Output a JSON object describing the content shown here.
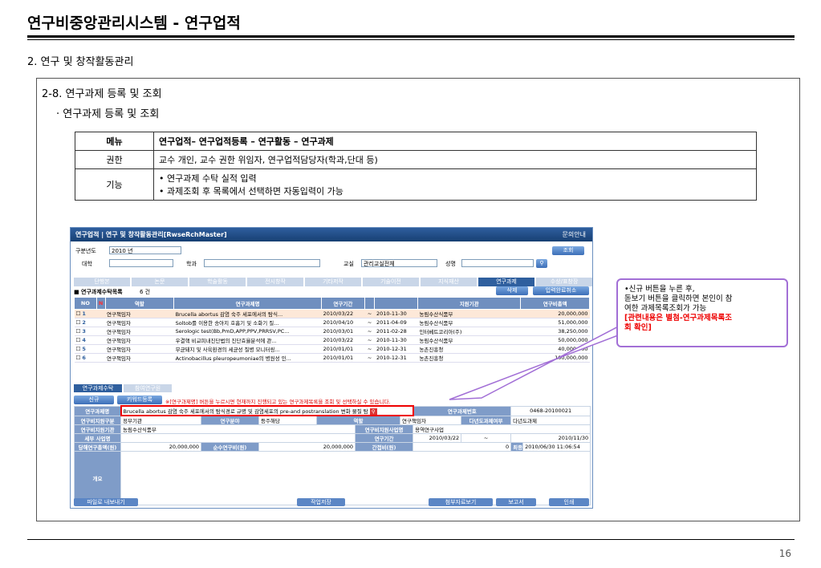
{
  "doc": {
    "title": "연구비중앙관리시스템 - 연구업적",
    "section": "2. 연구 및 창작활동관리",
    "subsection": "2-8. 연구과제 등록 및 조회",
    "subsubsection": "· 연구과제 등록 및 조회",
    "page_number": "16"
  },
  "info_table": {
    "menu_label": "메뉴",
    "menu_value": "연구업적– 연구업적등록 – 연구활동 – 연구과제",
    "auth_label": "권한",
    "auth_value": "교수 개인, 교수 권한 위임자, 연구업적담당자(학과,단대 등)",
    "func_label": "기능",
    "func_value_1": "• 연구과제 수탁 실적 입력",
    "func_value_2": "• 과제조회 후 목록에서 선택하면 자동입력이 가능"
  },
  "app": {
    "title": "연구업적 | 연구 및 창작활동관리[RwseRchMaster]",
    "help": "문의안내",
    "year_label": "구분년도",
    "year_value": "2010 년",
    "search_button": "조회",
    "college_label": "대학",
    "dept_label": "학과",
    "office_label": "교실",
    "office_value": "관리교실전체",
    "name_label": "성명",
    "tabs": [
      "단행본",
      "논문",
      "학술활동",
      "전시창작",
      "기타저작",
      "기술이전",
      "지식재산",
      "연구과제",
      "수상/표창장"
    ],
    "list_title": "■ 연구과제수탁목록",
    "list_count": "6 건",
    "btn_delete": "삭제",
    "btn_cancel": "입력완료취소",
    "grid_headers": [
      "NO",
      "N",
      "역할",
      "연구과제명",
      "연구기간",
      "",
      "",
      "지원기관",
      "연구비총액"
    ],
    "rows": [
      [
        "1",
        "연구책임자",
        "Brucella abortus 감염 숙주 세포에서의 탐식...",
        "2010/03/22",
        "~",
        "2010-11-30",
        "농림수산식품부",
        "20,000,000"
      ],
      [
        "2",
        "연구책임자",
        "Soltob를 이용한 송아지 호흡기 및 소화기 질...",
        "2010/04/10",
        "~",
        "2011-04-09",
        "농림수산식품부",
        "51,000,000"
      ],
      [
        "3",
        "연구책임자",
        "Serologic test(Bb,PmD,APP,PPV,PRRSV,PC...",
        "2010/03/01",
        "~",
        "2011-02-28",
        "인터베트코리아(주)",
        "38,250,000"
      ],
      [
        "4",
        "연구책임자",
        "우결핵 비교피내진단법의 진단효율분석에 관...",
        "2010/03/22",
        "~",
        "2010-11-30",
        "농림수산식품부",
        "50,000,000"
      ],
      [
        "5",
        "연구책임자",
        "무균돼지 및 사육환경의 세균성 질병 모니터링...",
        "2010/01/01",
        "~",
        "2010-12-31",
        "농촌진흥청",
        "40,000,000"
      ],
      [
        "6",
        "연구책임자",
        "Actinobacillus pleuropeumoniae의 병원성 인...",
        "2010/01/01",
        "~",
        "2010-12-31",
        "농촌진흥청",
        "100,000,000"
      ]
    ],
    "form_tabs": [
      "연구과제수탁",
      "참여연구원"
    ],
    "btn_new": "신규",
    "btn_keyword": "키워드등록",
    "notice": "※[연구과제명] 버튼을 누르시면 현재까지 진행되고 있는 연구과제목록을 조회 및 선택하실 수 있습니다.",
    "f_name_label": "연구과제명",
    "f_name_value": "Brucella abortus 감염 숙주 세포에서의 탐식경로 규명 및 감염세포의 pre-and postranslation 변화 물질 탐",
    "f_no_label": "연구과제번호",
    "f_no_value": "0468-20100021",
    "f_support_label": "연구비지원구분",
    "f_support_value": "정부기관",
    "f_field_label": "연구분야",
    "f_field_value": "등주해당",
    "f_role_label": "역할",
    "f_role_value": "연구책임자",
    "f_multi_label": "다년도과제여부",
    "f_multi_value": "다년도과제",
    "f_agency_label": "연구비지원기관",
    "f_agency_value": "농림수산식품부",
    "f_biz_label": "연구비지원사업명",
    "f_biz_value": "용역연구사업",
    "f_sub_label": "세부 사업명",
    "f_period_label": "연구기간",
    "f_start": "2010/03/22",
    "f_tilde": "~",
    "f_end": "2010/11/30",
    "f_total_label": "당해연구총액(원)",
    "f_total_value": "20,000,000",
    "f_net_label": "순수연구비(원)",
    "f_net_value": "20,000,000",
    "f_indirect_label": "간접비(원)",
    "f_indirect_value": "0",
    "f_final_label": "최종일시",
    "f_final_value": "2010/06/30 11:06:54",
    "f_summary_label": "개요",
    "foot_export": "파일로 내보내기",
    "foot_save": "작업저장",
    "foot_attach": "첨부자료보기",
    "foot_report": "보고서",
    "foot_print": "인쇄"
  },
  "callout": {
    "line1": "•신규 버튼을 누른 후,",
    "line2": "돋보기 버튼을 클릭하면 본인이 참",
    "line3": "여한 과제목록조회가 가능",
    "line4": "[관련내용은 별첨-연구과제목록조",
    "line5": "회 확인]",
    "accent": "#a26fd6"
  }
}
